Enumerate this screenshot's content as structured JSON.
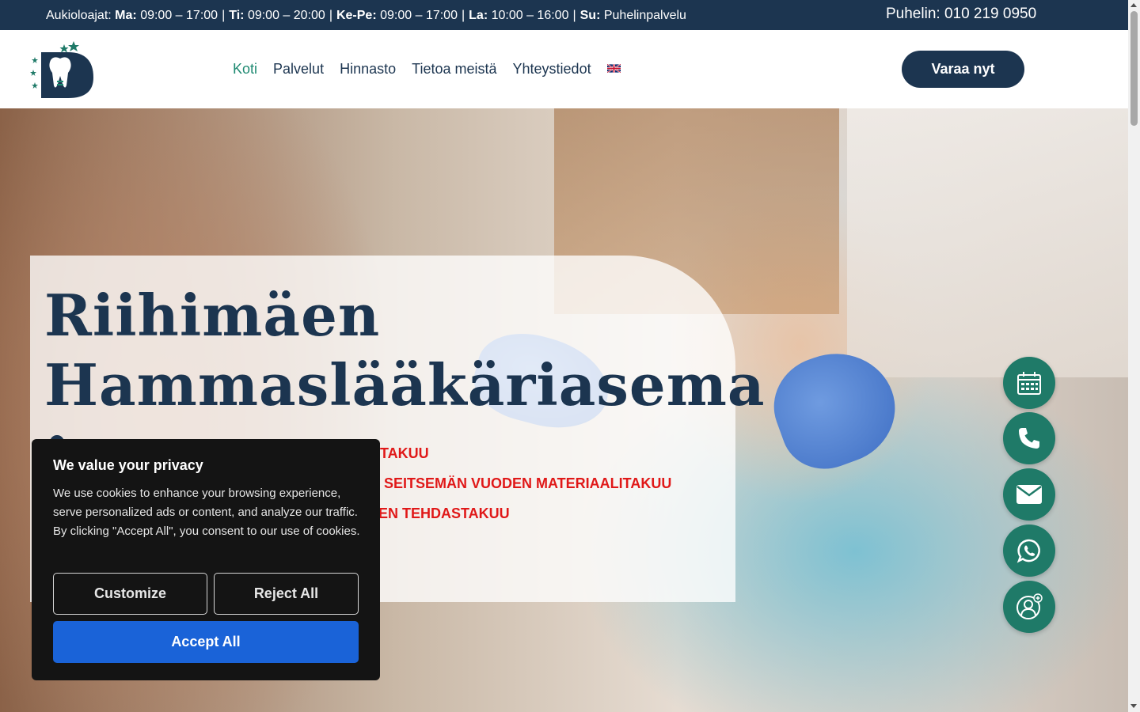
{
  "topbar": {
    "hours_prefix": "Aukioloajat:",
    "hours": [
      {
        "day": "Ma:",
        "time": "09:00 – 17:00"
      },
      {
        "day": "Ti:",
        "time": "09:00 – 20:00"
      },
      {
        "day": "Ke-Pe:",
        "time": "09:00 – 17:00"
      },
      {
        "day": "La:",
        "time": "10:00 – 16:00"
      },
      {
        "day": "Su:",
        "time": "Puhelinpalvelu"
      }
    ],
    "separator": "|",
    "phone": "Puhelin: 010 219 0950"
  },
  "nav": {
    "items": [
      {
        "label": "Koti",
        "active": true
      },
      {
        "label": "Palvelut",
        "active": false
      },
      {
        "label": "Hinnasto",
        "active": false
      },
      {
        "label": "Tietoa meistä",
        "active": false
      },
      {
        "label": "Yhteystiedot",
        "active": false
      }
    ],
    "language_icon": "uk-flag-icon",
    "cta_label": "Varaa nyt"
  },
  "hero": {
    "title_line1": "Riihimäen",
    "title_line2": "Hammaslääkäriasema",
    "guarantee_lines": [
      "TAKUU",
      "SEITSEMÄN VUODEN MATERIAALITAKUU",
      "EN TEHDASTAKUU"
    ]
  },
  "floating_buttons": [
    {
      "icon": "calendar-icon"
    },
    {
      "icon": "phone-icon"
    },
    {
      "icon": "envelope-icon"
    },
    {
      "icon": "whatsapp-icon"
    },
    {
      "icon": "patient-add-icon"
    }
  ],
  "cookie": {
    "title": "We value your privacy",
    "text": "We use cookies to enhance your browsing experience, serve personalized ads or content, and analyze our traffic. By clicking \"Accept All\", you consent to our use of cookies.",
    "customize_label": "Customize",
    "reject_label": "Reject All",
    "accept_label": "Accept All"
  },
  "colors": {
    "navy": "#1c3550",
    "teal": "#1f7a68",
    "active_nav": "#1f8a72",
    "red": "#e01818",
    "cookie_bg": "#141414",
    "accept_blue": "#1a63d8"
  }
}
